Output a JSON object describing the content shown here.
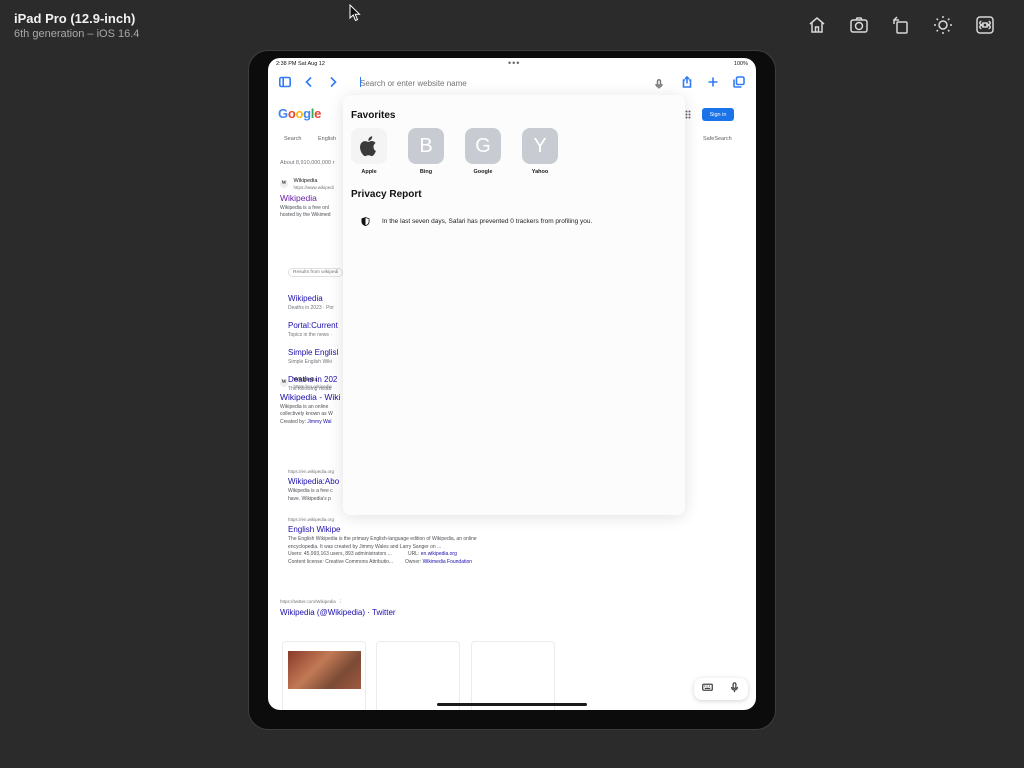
{
  "simulator": {
    "device_name": "iPad Pro (12.9-inch)",
    "device_sub": "6th generation – iOS 16.4",
    "tools": [
      "home-icon",
      "screenshot-icon",
      "rotate-icon",
      "brightness-icon",
      "command-icon"
    ]
  },
  "statusbar": {
    "time": "2:38 PM  Sat Aug 12",
    "dots": "•••",
    "battery": "100%"
  },
  "toolbar": {
    "url_placeholder": "Search or enter website name",
    "icons": [
      "sidebar-icon",
      "back-icon",
      "forward-icon",
      "mic-icon",
      "share-icon",
      "new-tab-icon",
      "tabs-icon"
    ]
  },
  "google": {
    "logo": [
      "G",
      "o",
      "o",
      "g",
      "l",
      "e"
    ],
    "signin": "Sign in",
    "tabs": [
      "Search",
      "English"
    ],
    "safesearch": "SafeSearch",
    "result_count": "About 8,910,000,000 r",
    "result1": {
      "site": "Wikipedia",
      "url": "https://www.wikipedi",
      "title": "Wikipedia",
      "snippet1": "Wikipedia is a free onl",
      "snippet2": "hosted by the Wikimed"
    },
    "chip": "Results from wikipedi",
    "sublinks": [
      {
        "title": "Wikipedia",
        "desc": "Deaths in 2023 · Por"
      },
      {
        "title": "Portal:Current",
        "desc": "Topics in the news ·"
      },
      {
        "title": "Simple Englisl",
        "desc": "Simple English Wiki"
      },
      {
        "title": "Deaths in 202",
        "desc": "The following notab"
      }
    ],
    "result2": {
      "site": "Wikipedia",
      "url": "https://en.wikipedia",
      "title": "Wikipedia - Wiki",
      "snippet1": "Wikipedia is an online",
      "snippet2": "collectively known as W",
      "created_label": "Created by:",
      "created_value": "Jimmy Wal"
    },
    "result3": {
      "url": "https://en.wikipedia.org",
      "title": "Wikipedia:Abo",
      "snippet1": "Wikipedia is a free c",
      "snippet2": "have. Wikipedia's p"
    },
    "result4": {
      "url": "https://en.wikipedia.org",
      "title": "English Wikipe",
      "snippet1": "The English Wikipedia is the primary English-language edition of Wikipedia, an online",
      "snippet2": "encyclopedia. It was created by Jimmy Wales and Larry Sanger on ...",
      "users": "Users: 45,993,163 users, 893 administrators ...",
      "url_label": "URL:",
      "url_value": "en.wikipedia.org",
      "license": "Content license: Creative Commons Attributio...",
      "owner_label": "Owner:",
      "owner_value": "Wikimedia Foundation"
    },
    "twitter": {
      "url": "https://twitter.com/Wikipedia",
      "title": "Wikipedia (@Wikipedia) · Twitter"
    }
  },
  "popover": {
    "favorites_heading": "Favorites",
    "favorites": [
      {
        "letter": "",
        "label": "Apple",
        "icon": "apple-icon"
      },
      {
        "letter": "B",
        "label": "Bing"
      },
      {
        "letter": "G",
        "label": "Google"
      },
      {
        "letter": "Y",
        "label": "Yahoo"
      }
    ],
    "privacy_heading": "Privacy Report",
    "privacy_text": "In the last seven days, Safari has prevented 0 trackers from profiling you."
  }
}
